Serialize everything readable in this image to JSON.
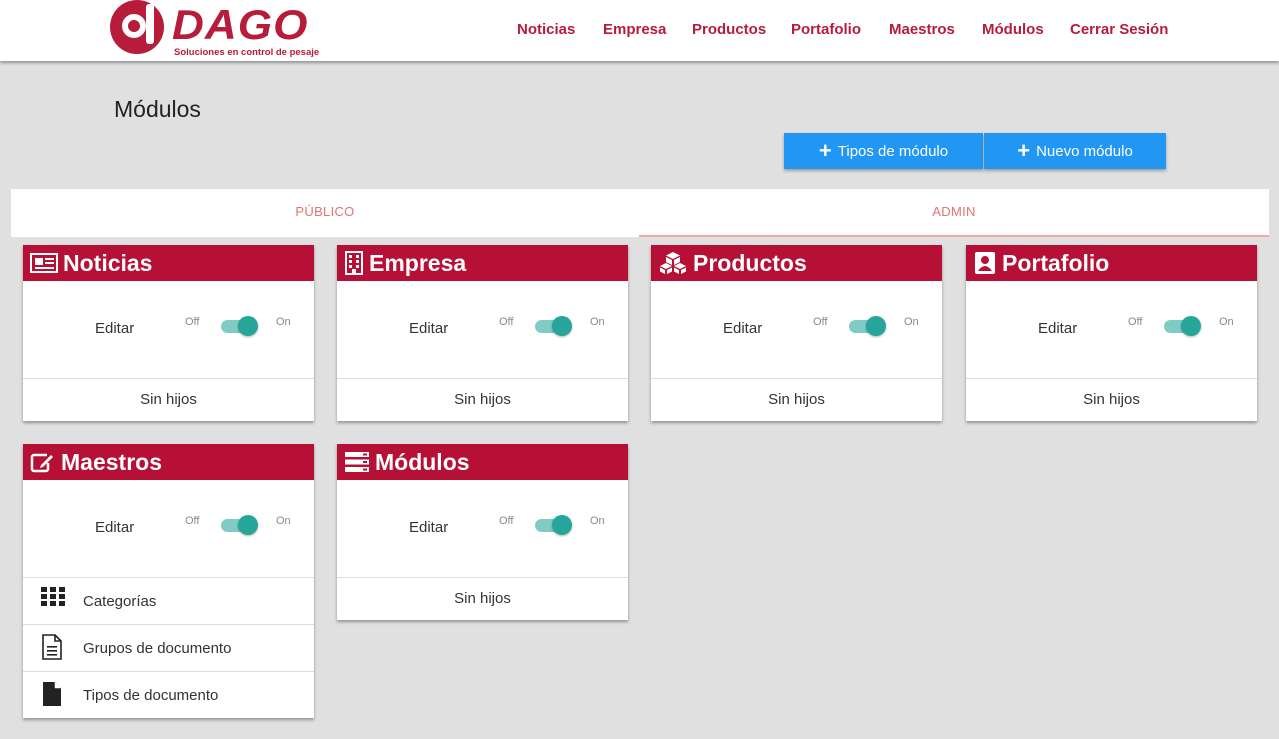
{
  "brand": {
    "name": "DAGO",
    "tagline": "Soluciones en control de pesaje",
    "color": "#b71c3b"
  },
  "nav": [
    "Noticias",
    "Empresa",
    "Productos",
    "Portafolio",
    "Maestros",
    "Módulos",
    "Cerrar Sesión"
  ],
  "page": {
    "title": "Módulos"
  },
  "buttons": {
    "tipos": "Tipos de módulo",
    "nuevo": "Nuevo módulo"
  },
  "tabs": [
    {
      "label": "PÚBLICO"
    },
    {
      "label": "ADMIN"
    }
  ],
  "toggle": {
    "edit": "Editar",
    "off": "Off",
    "on": "On"
  },
  "cards": [
    {
      "title": "Noticias",
      "icon": "newspaper-icon",
      "enabled": true,
      "children_text": "Sin hijos"
    },
    {
      "title": "Empresa",
      "icon": "building-icon",
      "enabled": true,
      "children_text": "Sin hijos"
    },
    {
      "title": "Productos",
      "icon": "cubes-icon",
      "enabled": true,
      "children_text": "Sin hijos"
    },
    {
      "title": "Portafolio",
      "icon": "contact-book-icon",
      "enabled": true,
      "children_text": "Sin hijos"
    },
    {
      "title": "Maestros",
      "icon": "edit-icon",
      "enabled": true,
      "children": [
        {
          "label": "Categorías",
          "icon": "grid-icon"
        },
        {
          "label": "Grupos de documento",
          "icon": "document-lines-icon"
        },
        {
          "label": "Tipos de documento",
          "icon": "document-filled-icon"
        }
      ]
    },
    {
      "title": "Módulos",
      "icon": "server-list-icon",
      "enabled": true,
      "children_text": "Sin hijos"
    }
  ],
  "colors": {
    "card_header": "#b71036",
    "primary_button": "#2196f3",
    "toggle": "#26a69a",
    "tab_text": "#e57373"
  }
}
